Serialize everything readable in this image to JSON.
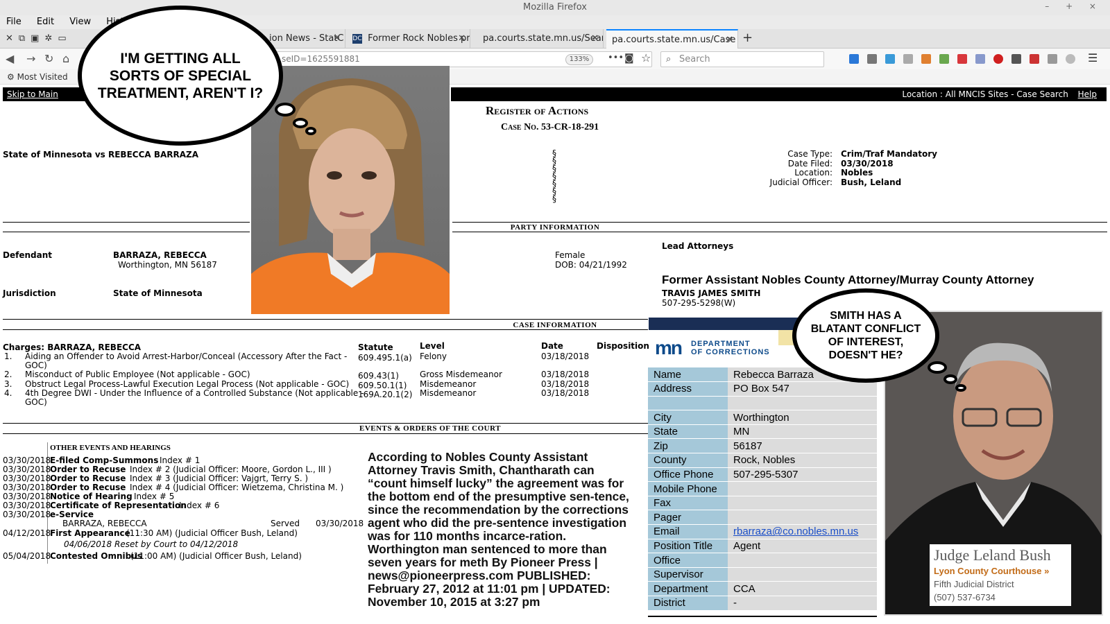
{
  "window": {
    "title": "Mozilla Firefox",
    "controls": "– + ×"
  },
  "menu": {
    "items": [
      "File",
      "Edit",
      "View",
      "History"
    ]
  },
  "tabs": [
    {
      "label": "ion News - StatC"
    },
    {
      "label": "Former Rock Nobles pro"
    },
    {
      "label": "pa.courts.state.mn.us/Searc"
    },
    {
      "label": "pa.courts.state.mn.us/Case"
    }
  ],
  "nav": {
    "url": "seID=1625591881",
    "zoom": "133%",
    "search_placeholder": "Search",
    "bookmarks_label": "Most Visited",
    "more": "•••"
  },
  "page": {
    "skip_link": "Skip to Main Content",
    "location_text": "Location : All MNCIS Sites - Case Search",
    "help": "Help",
    "title": "Register of Actions",
    "case_no": "Case No. 53-CR-18-291",
    "case_caption": "State of Minnesota vs REBECCA BARRAZA",
    "section_marks": "§ § § § § § §",
    "case_type_label": "Case Type:",
    "case_type": "Crim/Traf Mandatory",
    "date_filed_label": "Date Filed:",
    "date_filed": "03/30/2018",
    "location_label": "Location:",
    "location": "Nobles",
    "judicial_officer_label": "Judicial Officer:",
    "judicial_officer": "Bush, Leland",
    "party_info_head": "Party Information",
    "lead_attorneys": "Lead Attorneys",
    "defendant_label": "Defendant",
    "defendant_name": "BARRAZA, REBECCA",
    "defendant_city": "Worthington, MN 56187",
    "gender": "Female",
    "dob": "DOB: 04/21/1992",
    "jurisdiction_label": "Jurisdiction",
    "jurisdiction": "State of Minnesota",
    "attorney_title": "Former Assistant Nobles County Attorney/Murray County Attorney",
    "attorney_name": "TRAVIS JAMES SMITH",
    "attorney_phone": "507-295-5298(W)",
    "case_info_head": "Case Information",
    "charges_label": "Charges: BARRAZA, REBECCA",
    "col_statute": "Statute",
    "col_level": "Level",
    "col_date": "Date",
    "col_disposition": "Disposition",
    "charges": [
      {
        "num": "1.",
        "desc": "Aiding an Offender to Avoid Arrest-Harbor/Conceal (Accessory After the Fact -",
        "desc2": "GOC)",
        "statute": "609.495.1(a)",
        "level": "Felony",
        "date": "03/18/2018"
      },
      {
        "num": "2.",
        "desc": "Misconduct of Public Employee (Not applicable - GOC)",
        "desc2": "",
        "statute": "609.43(1)",
        "level": "Gross Misdemeanor",
        "date": "03/18/2018"
      },
      {
        "num": "3.",
        "desc": "Obstruct Legal Process-Lawful Execution Legal Process (Not applicable - GOC)",
        "desc2": "",
        "statute": "609.50.1(1)",
        "level": "Misdemeanor",
        "date": "03/18/2018"
      },
      {
        "num": "4.",
        "desc": "4th Degree DWI - Under the Influence of a Controlled Substance (Not applicable -",
        "desc2": "GOC)",
        "statute": "169A.20.1(2)",
        "level": "Misdemeanor",
        "date": "03/18/2018"
      }
    ],
    "events_head": "Events & Orders of the Court",
    "other_events_head": "Other Events and Hearings",
    "events": [
      {
        "date": "03/30/2018",
        "name": "E-filed Comp-Summons",
        "detail": "Index # 1"
      },
      {
        "date": "03/30/2018",
        "name": "Order to Recuse",
        "detail": "Index # 2 (Judicial Officer: Moore, Gordon L., III )"
      },
      {
        "date": "03/30/2018",
        "name": "Order to Recuse",
        "detail": "Index # 3 (Judicial Officer: Vajgrt, Terry S. )"
      },
      {
        "date": "03/30/2018",
        "name": "Order to Recuse",
        "detail": "Index # 4 (Judicial Officer: Wietzema, Christina M. )"
      },
      {
        "date": "03/30/2018",
        "name": "Notice of Hearing",
        "detail": "Index # 5"
      },
      {
        "date": "03/30/2018",
        "name": "Certificate of Representation",
        "detail": "Index # 6"
      },
      {
        "date": "03/30/2018",
        "name": "e-Service",
        "detail": ""
      }
    ],
    "served_name": "BARRAZA, REBECCA",
    "served_label": "Served",
    "served_date": "03/30/2018",
    "first_appearance_date": "04/12/2018",
    "first_appearance": "First Appearance",
    "first_appearance_detail": "(11:30 AM) (Judicial Officer Bush, Leland)",
    "reset_note": "04/06/2018 Reset by Court to 04/12/2018",
    "omnibus_date": "05/04/2018",
    "omnibus": "Contested Omnibus",
    "omnibus_detail": "(11:00 AM) (Judicial Officer Bush, Leland)"
  },
  "bubbles": {
    "left": "I'M GETTING ALL SORTS OF SPECIAL TREATMENT, AREN'T I?",
    "right": "SMITH HAS A BLATANT CONFLICT OF INTEREST, DOESN'T HE?"
  },
  "article": "According to Nobles County Assistant Attorney Travis Smith, Chantharath can “count himself lucky” the agreement was for the bottom end of the presumptive sen-tence, since the recommendation by the corrections agent who did the pre-sentence investigation was for 110 months incarce-ration. Worthington man sentenced to more than seven years for meth By Pioneer Press | news@pioneerpress.com PUBLISHED: February 27, 2012 at 11:01 pm | UPDATED: November 10, 2015 at 3:27 pm",
  "corrections": {
    "logo_mn": "mn",
    "logo_line1": "DEPARTMENT",
    "logo_line2": "OF CORRECTIONS",
    "rows": [
      {
        "k": "Name",
        "v": "Rebecca Barraza"
      },
      {
        "k": "Address",
        "v": "PO Box 547"
      },
      {
        "k": "",
        "v": ""
      },
      {
        "k": "City",
        "v": "Worthington"
      },
      {
        "k": "State",
        "v": "MN"
      },
      {
        "k": "Zip",
        "v": "56187"
      },
      {
        "k": "County",
        "v": "Rock, Nobles"
      },
      {
        "k": "Office Phone",
        "v": "507-295-5307"
      },
      {
        "k": "Mobile Phone",
        "v": ""
      },
      {
        "k": "Fax",
        "v": ""
      },
      {
        "k": "Pager",
        "v": ""
      },
      {
        "k": "Email",
        "v": "rbarraza@co.nobles.mn.us"
      },
      {
        "k": "Position Title",
        "v": "Agent"
      },
      {
        "k": "Office",
        "v": ""
      },
      {
        "k": "Supervisor",
        "v": ""
      },
      {
        "k": "Department",
        "v": "CCA"
      },
      {
        "k": "District",
        "v": "-"
      }
    ]
  },
  "judge": {
    "name": "Judge Leland Bush",
    "court": "Lyon County Courthouse »",
    "district": "Fifth Judicial District",
    "phone": "(507) 537-6734"
  }
}
